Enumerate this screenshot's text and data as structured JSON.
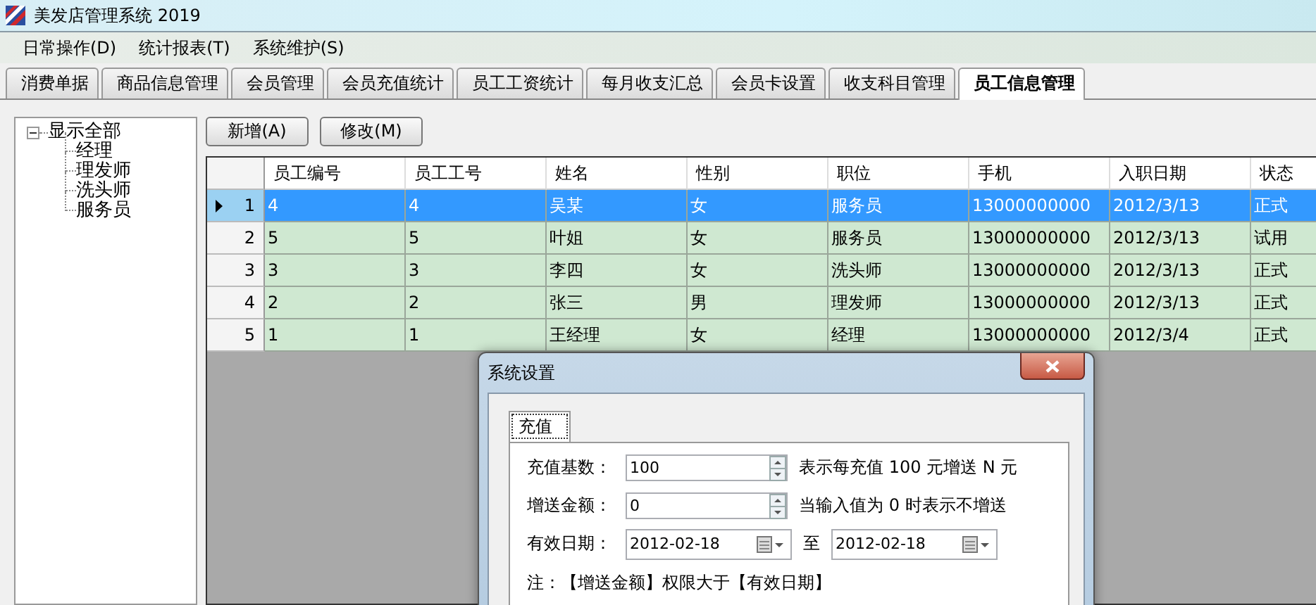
{
  "window": {
    "title": "美发店管理系统 2019"
  },
  "menu": [
    "日常操作(D)",
    "统计报表(T)",
    "系统维护(S)"
  ],
  "tabs": [
    {
      "label": "消费单据",
      "selected": false
    },
    {
      "label": "商品信息管理",
      "selected": false
    },
    {
      "label": "会员管理",
      "selected": false
    },
    {
      "label": "会员充值统计",
      "selected": false
    },
    {
      "label": "员工工资统计",
      "selected": false
    },
    {
      "label": "每月收支汇总",
      "selected": false
    },
    {
      "label": "会员卡设置",
      "selected": false
    },
    {
      "label": "收支科目管理",
      "selected": false
    },
    {
      "label": "员工信息管理",
      "selected": true
    }
  ],
  "tree": [
    {
      "label": "显示全部",
      "expanded": true,
      "children": [
        {
          "label": "经理"
        },
        {
          "label": "理发师"
        },
        {
          "label": "洗头师"
        },
        {
          "label": "服务员"
        }
      ]
    }
  ],
  "buttons": [
    "新增(A)",
    "修改(M)"
  ],
  "table": {
    "columns": [
      "员工编号",
      "员工工号",
      "姓名",
      "性别",
      "职位",
      "手机",
      "入职日期",
      "状态"
    ],
    "rows": [
      {
        "number": "1",
        "selected": true,
        "cells": [
          "4",
          "4",
          "吴某",
          "女",
          "服务员",
          "13000000000",
          "2012/3/13",
          "正式"
        ]
      },
      {
        "number": "2",
        "selected": false,
        "cells": [
          "5",
          "5",
          "叶姐",
          "女",
          "服务员",
          "13000000000",
          "2012/3/13",
          "试用"
        ]
      },
      {
        "number": "3",
        "selected": false,
        "cells": [
          "3",
          "3",
          "李四",
          "女",
          "洗头师",
          "13000000000",
          "2012/3/13",
          "正式"
        ]
      },
      {
        "number": "4",
        "selected": false,
        "cells": [
          "2",
          "2",
          "张三",
          "男",
          "理发师",
          "13000000000",
          "2012/3/13",
          "正式"
        ]
      },
      {
        "number": "5",
        "selected": false,
        "cells": [
          "1",
          "1",
          "王经理",
          "女",
          "经理",
          "13000000000",
          "2012/3/4",
          "正式"
        ]
      }
    ]
  },
  "dialog": {
    "title": "系统设置",
    "tabs": [
      {
        "label": "充值",
        "selected": true
      }
    ],
    "fields": [
      {
        "kind": "spin",
        "label": "充值基数：",
        "value": "100",
        "hint": "表示每充值 100 元增送 N 元"
      },
      {
        "kind": "spin",
        "label": "增送金额：",
        "value": "0",
        "hint": "当输入值为 0 时表示不增送"
      },
      {
        "kind": "daterange",
        "label": "有效日期：",
        "value": "2012-02-18",
        "separator": "至",
        "value_end": "2012-02-18"
      }
    ],
    "note": "注：【增送金额】权限大于【有效日期】"
  }
}
